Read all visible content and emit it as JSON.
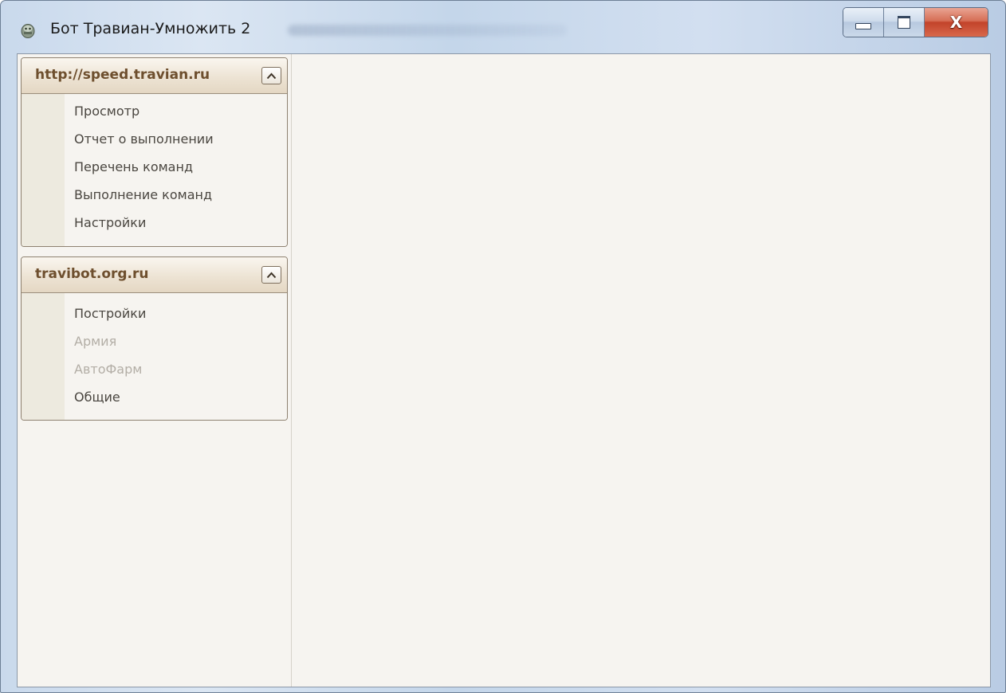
{
  "window": {
    "title": "Бот Травиан-Умножить 2",
    "icon": "app-icon"
  },
  "caption_buttons": {
    "minimize": "minimize-icon",
    "maximize": "maximize-icon",
    "close_glyph": "X"
  },
  "sidebar": {
    "groups": [
      {
        "title": "http://speed.travian.ru",
        "collapse_icon": "chevron-up-icon",
        "items": [
          {
            "label": "Просмотр",
            "enabled": true
          },
          {
            "label": "Отчет о выполнении",
            "enabled": true
          },
          {
            "label": "Перечень команд",
            "enabled": true
          },
          {
            "label": "Выполнение команд",
            "enabled": true
          },
          {
            "label": "Настройки",
            "enabled": true
          }
        ]
      },
      {
        "title": "travibot.org.ru",
        "collapse_icon": "chevron-up-icon",
        "items": [
          {
            "label": "Постройки",
            "enabled": true
          },
          {
            "label": "Армия",
            "enabled": false
          },
          {
            "label": "АвтоФарм",
            "enabled": false
          },
          {
            "label": "Общие",
            "enabled": true
          }
        ]
      }
    ]
  },
  "colors": {
    "group_title": "#6e4f2e",
    "item_text": "#4a4640",
    "item_disabled": "#b3aea6",
    "close_button": "#c2432a",
    "panel_background": "#f6f4f0"
  }
}
